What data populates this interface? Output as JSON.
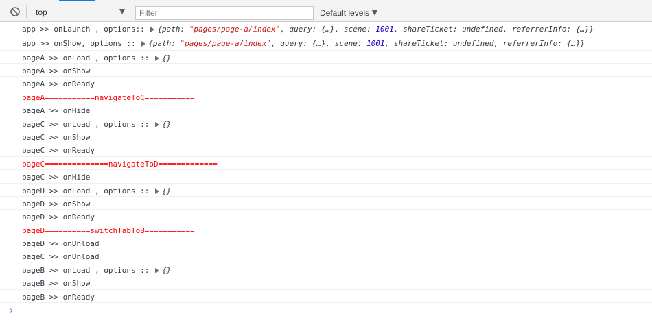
{
  "toolbar": {
    "context": "top",
    "filter_placeholder": "Filter",
    "levels": "Default levels"
  },
  "launch": {
    "prefix": "app >> onLaunch ,  options:: ",
    "path": "\"pages/page-a/index\"",
    "scene": "1001",
    "shareTicket": "undefined"
  },
  "show": {
    "prefix": "app >> onShow,  options :: ",
    "path": "\"pages/page-a/index\"",
    "scene": "1001",
    "shareTicket": "undefined"
  },
  "logs": [
    "pageA >> onLoad , options :: ",
    "pageA >> onShow",
    "pageA >> onReady",
    "pageA===========navigateToC===========",
    "pageA >> onHide",
    "pageC >> onLoad , options :: ",
    "pageC >> onShow",
    "pageC >> onReady",
    "pageC==============navigateToD=============",
    "pageC >> onHide",
    "pageD >> onLoad , options :: ",
    "pageD >> onShow",
    "pageD >> onReady",
    "pageD==========switchTabToB===========",
    "pageD >> onUnload",
    "pageC >> onUnload",
    "pageB >> onLoad , options :: ",
    "pageB >> onShow",
    "pageB >> onReady"
  ],
  "empty_obj": "{}",
  "colors": {
    "error_red": "#ff0000",
    "string_red": "#c41a16",
    "number_blue": "#1c00cf",
    "prompt_blue": "#1a73e8"
  }
}
